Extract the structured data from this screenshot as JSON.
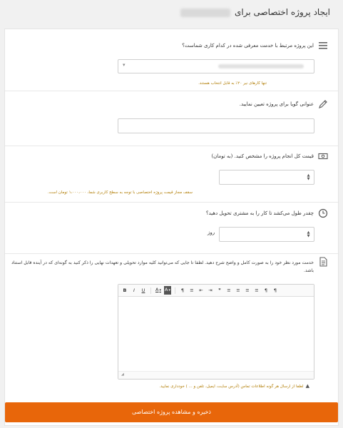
{
  "header": {
    "title": "ایجاد پروژه اختصاصی برای"
  },
  "section_service": {
    "question": "این پروژه مرتبط با خدمت معرفی شده در کدام کاری شماست؟",
    "hint": "تنها کارهای نیر ۲۰٪ به قابل انتخاب هستند.",
    "icon": "list-icon"
  },
  "section_title": {
    "question": "عنوانی گویا برای پروژه تعیین نمایید.",
    "value": "",
    "icon": "pencil-icon"
  },
  "section_price": {
    "question": "قیمت کل انجام پروژه را مشخص کنید. (به تومان)",
    "hint": "سقف مجاز قیمت پروژه اختصاصی با توجه به سطح کاربری شما، ۱،۰۰۰،۰۰۰ تومان است.",
    "value": "",
    "icon": "money-icon"
  },
  "section_duration": {
    "question": "چقدر طول می‌کشد تا کار را به مشتری تحویل دهید؟",
    "unit": "روز",
    "value": "",
    "icon": "clock-icon"
  },
  "section_description": {
    "question": "خدمت مورد نظر خود را به صورت کامل و واضح شرح دهید. لطفا تا جایی که می‌توانید کلیه موارد تحویلی و تعهدات نهایی را ذکر کنید به گونه‌ای که در آینده قابل استناد باشد.",
    "icon": "document-icon",
    "toolbar": [
      "B",
      "I",
      "U",
      "A",
      "A",
      "¶",
      "≡",
      "⇤",
      "⇥",
      "❞",
      "≡",
      "≡",
      "≡",
      "≡",
      "¶",
      "¶"
    ]
  },
  "warning": "لطفا از ارسال هر گونه اطلاعات تماس (آدرس سایت، ایمیل، تلفن و ... ) خودداری نمایید.",
  "submit_label": "ذخیره و مشاهده پروژه اختصاصی",
  "colors": {
    "accent": "#e8660a",
    "hint": "#b07b00"
  }
}
